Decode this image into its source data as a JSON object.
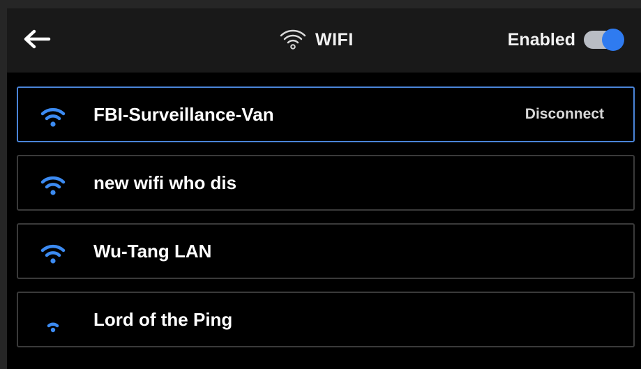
{
  "header": {
    "back_icon": "arrow-left-icon",
    "title_icon": "wifi-icon",
    "title": "WIFI",
    "enabled_label": "Enabled",
    "enabled": true,
    "toggle_color": "#2f7bf0"
  },
  "networks": [
    {
      "name": "FBI-Surveillance-Van",
      "signal_bars": 3,
      "selected": true,
      "action": "Disconnect"
    },
    {
      "name": "new wifi who dis",
      "signal_bars": 3
    },
    {
      "name": "Wu-Tang LAN",
      "signal_bars": 3
    },
    {
      "name": "Lord of the Ping",
      "signal_bars": 1
    }
  ],
  "colors": {
    "accent": "#2f7bf0",
    "signal": "#3c8bf2",
    "selected_border": "#4a84d8"
  }
}
